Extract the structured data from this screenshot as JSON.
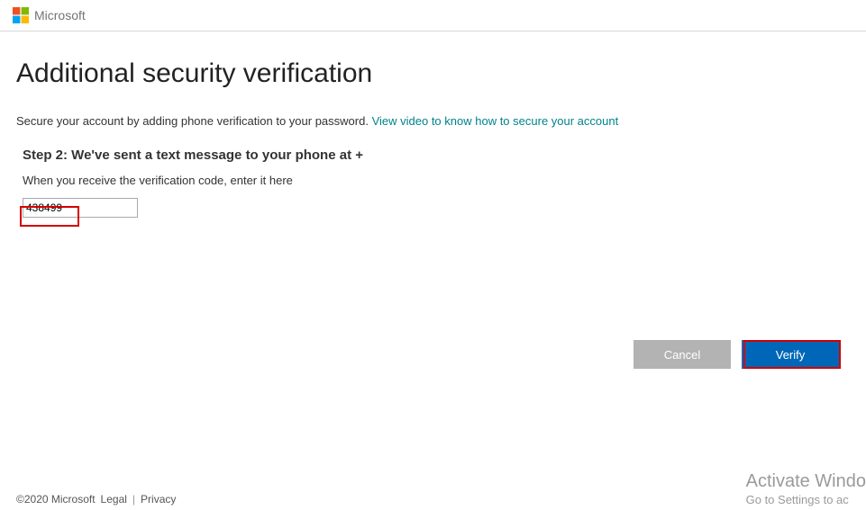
{
  "header": {
    "brand": "Microsoft"
  },
  "page": {
    "title": "Additional security verification",
    "subtitle_text": "Secure your account by adding phone verification to your password. ",
    "subtitle_link": "View video to know how to secure your account"
  },
  "step": {
    "heading": "Step 2: We've sent a text message to your phone at +",
    "instruction": "When you receive the verification code, enter it here",
    "code_value": "438499"
  },
  "buttons": {
    "cancel": "Cancel",
    "verify": "Verify"
  },
  "footer": {
    "copyright": "©2020 Microsoft",
    "legal": "Legal",
    "privacy": "Privacy"
  },
  "watermark": {
    "line1": "Activate Windo",
    "line2": "Go to Settings to ac"
  }
}
